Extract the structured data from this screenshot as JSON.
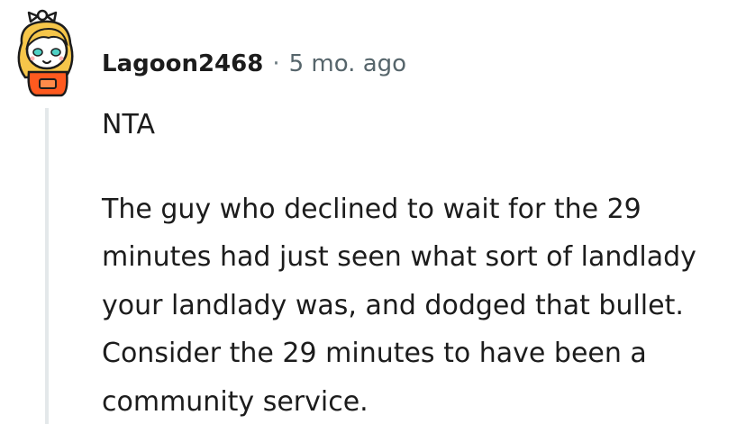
{
  "comment": {
    "username": "Lagoon2468",
    "separator": "·",
    "time_ago": "5 mo. ago",
    "paragraphs": [
      "NTA",
      "The guy who declined to wait for the 29 minutes had just seen what sort of landlady your landlady was, and dodged that bullet. Consider the 29 minutes to have been a community service."
    ]
  },
  "colors": {
    "avatar_hair": "#f6c64a",
    "avatar_shirt": "#ff5a1f",
    "avatar_eyes": "#4fd1c5",
    "thread_line": "#e4e8ea",
    "meta_text": "#56656b"
  },
  "icons": {
    "avatar": "snoo-avatar-icon"
  }
}
